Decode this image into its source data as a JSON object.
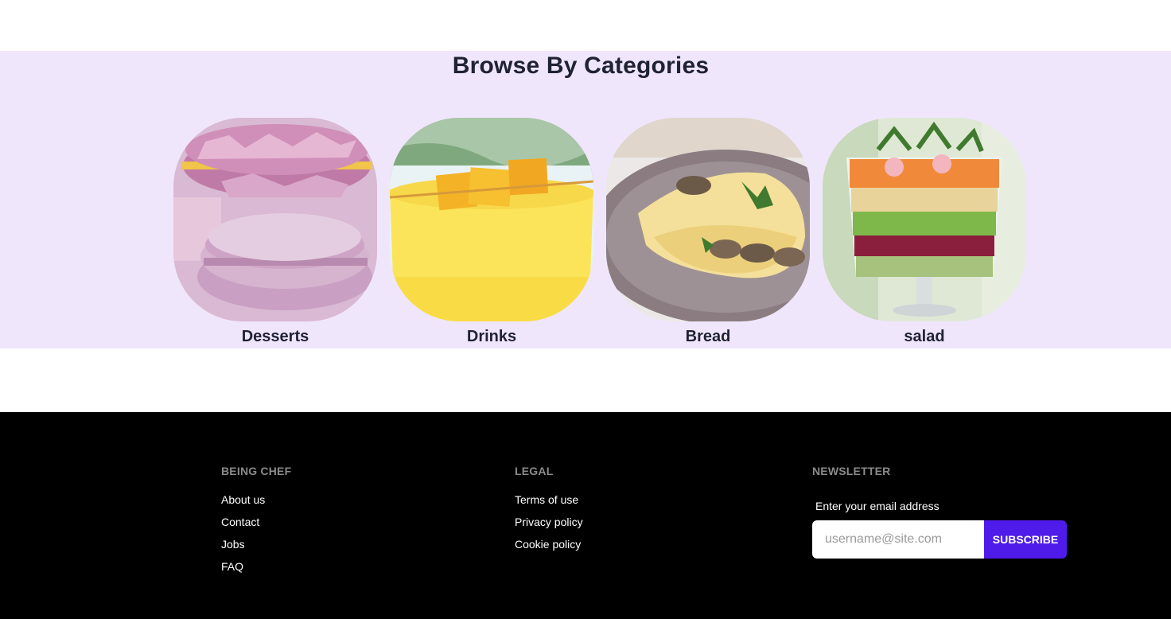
{
  "categories": {
    "title": "Browse By Categories",
    "items": [
      {
        "label": "Desserts",
        "icon": "macaron-image"
      },
      {
        "label": "Drinks",
        "icon": "mango-drink-image"
      },
      {
        "label": "Bread",
        "icon": "omelette-image"
      },
      {
        "label": "salad",
        "icon": "layered-salad-image"
      }
    ]
  },
  "footer": {
    "being_chef": {
      "heading": "BEING CHEF",
      "links": [
        "About us",
        "Contact",
        "Jobs",
        "FAQ"
      ]
    },
    "legal": {
      "heading": "LEGAL",
      "links": [
        "Terms of use",
        "Privacy policy",
        "Cookie policy"
      ]
    },
    "newsletter": {
      "heading": "NEWSLETTER",
      "hint": "Enter your email address",
      "placeholder": "username@site.com",
      "button": "SUBSCRIBE"
    }
  },
  "colors": {
    "section_bg": "#f0e6fc",
    "footer_bg": "#000000",
    "accent": "#4f1bea"
  }
}
